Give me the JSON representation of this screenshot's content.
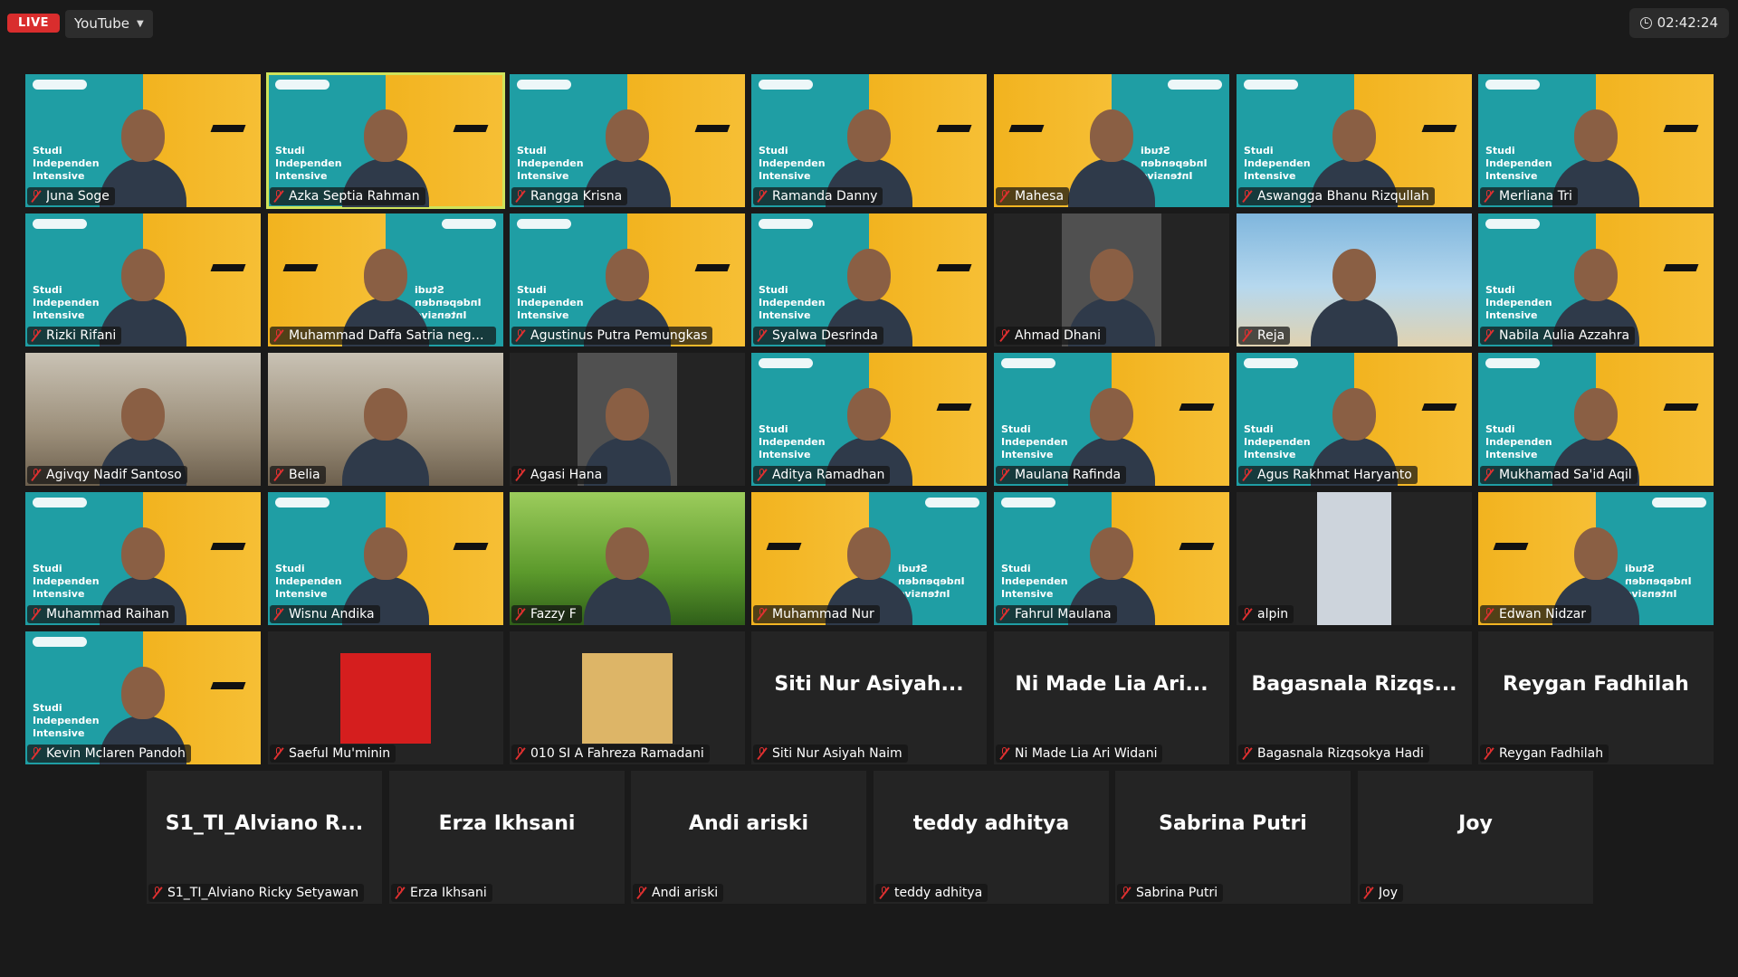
{
  "topbar": {
    "live_label": "LIVE",
    "stream_target": "YouTube",
    "elapsed_time": "02:42:24"
  },
  "participants": [
    {
      "name": "Juna Soge",
      "display": "",
      "style": "banner"
    },
    {
      "name": "Azka Septia Rahman",
      "display": "",
      "style": "banner",
      "active": true
    },
    {
      "name": "Rangga Krisna",
      "display": "",
      "style": "banner"
    },
    {
      "name": "Ramanda Danny",
      "display": "",
      "style": "banner"
    },
    {
      "name": "Mahesa",
      "display": "",
      "style": "banner-mirror"
    },
    {
      "name": "Aswangga Bhanu Rizqullah",
      "display": "",
      "style": "banner"
    },
    {
      "name": "Merliana Tri",
      "display": "",
      "style": "banner"
    },
    {
      "name": "Rizki Rifani",
      "display": "",
      "style": "banner"
    },
    {
      "name": "Muhammad Daffa Satria negar...",
      "display": "",
      "style": "banner-mirror"
    },
    {
      "name": "Agustinus Putra Pemungkas",
      "display": "",
      "style": "banner"
    },
    {
      "name": "Syalwa Desrinda",
      "display": "",
      "style": "banner"
    },
    {
      "name": "Ahmad Dhani",
      "display": "",
      "style": "video-narrow"
    },
    {
      "name": "Reja",
      "display": "",
      "style": "beach"
    },
    {
      "name": "Nabila Aulia Azzahra",
      "display": "",
      "style": "banner"
    },
    {
      "name": "Agivqy Nadif Santoso",
      "display": "",
      "style": "room"
    },
    {
      "name": "Belia",
      "display": "",
      "style": "room"
    },
    {
      "name": "Agasi Hana",
      "display": "",
      "style": "video-narrow"
    },
    {
      "name": "Aditya Ramadhan",
      "display": "",
      "style": "banner"
    },
    {
      "name": "Maulana Rafinda",
      "display": "",
      "style": "banner"
    },
    {
      "name": "Agus Rakhmat Haryanto",
      "display": "",
      "style": "banner"
    },
    {
      "name": "Mukhamad Sa'id Aqil",
      "display": "",
      "style": "banner"
    },
    {
      "name": "Muhammad Raihan",
      "display": "",
      "style": "banner"
    },
    {
      "name": "Wisnu Andika",
      "display": "",
      "style": "banner"
    },
    {
      "name": "Fazzy F",
      "display": "",
      "style": "grass"
    },
    {
      "name": "Muhammad Nur",
      "display": "",
      "style": "banner-mirror"
    },
    {
      "name": "Fahrul Maulana",
      "display": "",
      "style": "banner"
    },
    {
      "name": "alpin",
      "display": "",
      "style": "avatar-gray"
    },
    {
      "name": "Edwan Nidzar",
      "display": "",
      "style": "banner-mirror"
    },
    {
      "name": "Kevin Mclaren Pandoh",
      "display": "",
      "style": "banner"
    },
    {
      "name": "Saeful Mu'minin",
      "display": "",
      "style": "avatar-red"
    },
    {
      "name": "010 SI A Fahreza Ramadani",
      "display": "",
      "style": "avatar-tan"
    },
    {
      "name": "Siti Nur Asiyah Naim",
      "display": "Siti  Nur  Asiyah...",
      "style": "dark"
    },
    {
      "name": "Ni Made Lia Ari Widani",
      "display": "Ni Made Lia Ari...",
      "style": "dark"
    },
    {
      "name": "Bagasnala Rizqsokya Hadi",
      "display": "Bagasnala  Rizqs...",
      "style": "dark"
    },
    {
      "name": "Reygan Fadhilah",
      "display": "Reygan Fadhilah",
      "style": "dark"
    },
    {
      "name": "S1_TI_Alviano Ricky Setyawan",
      "display": "S1_TI_Alviano  R...",
      "style": "dark"
    },
    {
      "name": "Erza Ikhsani",
      "display": "Erza Ikhsani",
      "style": "dark"
    },
    {
      "name": "Andi ariski",
      "display": "Andi ariski",
      "style": "dark"
    },
    {
      "name": "teddy adhitya",
      "display": "teddy adhitya",
      "style": "dark"
    },
    {
      "name": "Sabrina Putri",
      "display": "Sabrina Putri",
      "style": "dark"
    },
    {
      "name": "Joy",
      "display": "Joy",
      "style": "dark"
    }
  ],
  "banner_text": "Studi\nIndependen\nIntensive",
  "colors": {
    "live_red": "#d92d2d",
    "active_speaker_outline": "#cfe35a",
    "banner_teal": "#1f9ea4",
    "banner_yellow": "#f2b31f",
    "mute_red": "#e03030"
  },
  "icons": {
    "timer": "clock-icon",
    "muted": "mic-muted-icon",
    "dropdown": "caret-down-icon"
  }
}
